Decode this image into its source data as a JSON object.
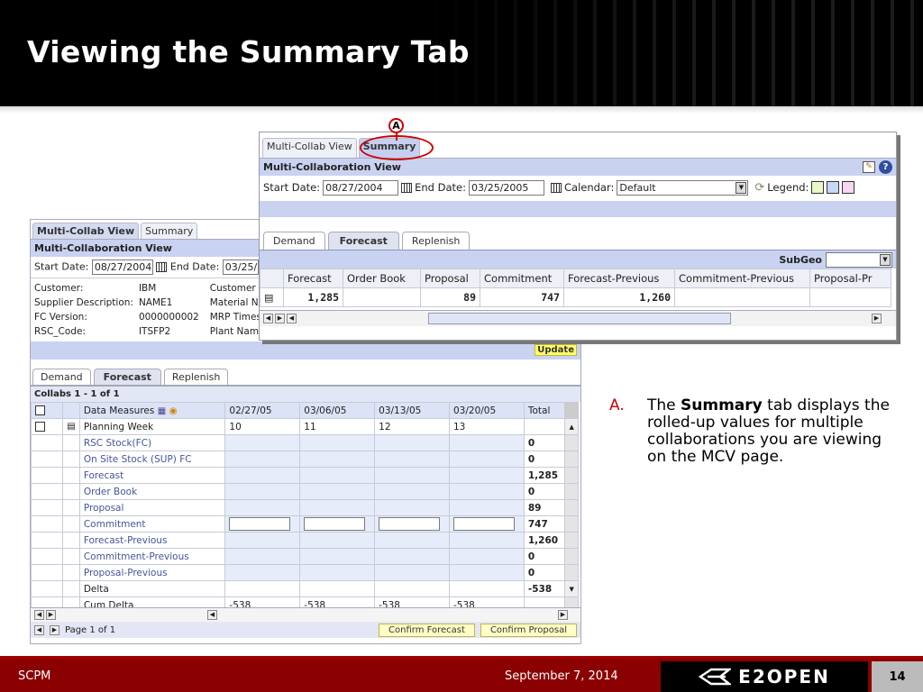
{
  "slide": {
    "title": "Viewing the Summary Tab",
    "footer_left": "SCPM",
    "footer_date": "September 7, 2014",
    "logo_text": "E2OPEN",
    "page_number": "14"
  },
  "callout": {
    "marker": "A",
    "letter": "A.",
    "prefix": "The",
    "bold": "Summary",
    "rest": "tab displays the rolled-up values for multiple collaborations you are viewing on the MCV page."
  },
  "front": {
    "tabs": [
      "Multi-Collab View",
      "Summary"
    ],
    "section_title": "Multi-Collaboration View",
    "start_label": "Start Date:",
    "start_value": "08/27/2004",
    "end_label": "End Date:",
    "end_value": "03/25/2005",
    "calendar_label": "Calendar:",
    "calendar_value": "Default",
    "legend_label": "Legend:",
    "legend_colors": [
      "#e8f8c8",
      "#c8d8f8",
      "#f8d8f0"
    ],
    "subtabs": [
      "Demand",
      "Forecast",
      "Replenish"
    ],
    "subgeo_label": "SubGeo",
    "columns": [
      "Forecast",
      "Order Book",
      "Proposal",
      "Commitment",
      "Forecast-Previous",
      "Commitment-Previous",
      "Proposal-Pr"
    ],
    "row": [
      "1,285",
      "",
      "89",
      "747",
      "1,260",
      "",
      ""
    ]
  },
  "back": {
    "tabs": [
      "Multi-Collab View",
      "Summary"
    ],
    "section_title": "Multi-Collaboration View",
    "start_label": "Start Date:",
    "start_value": "08/27/2004",
    "end_label": "End Date:",
    "end_value": "03/25/",
    "info": [
      [
        "Customer:",
        "IBM",
        "Customer"
      ],
      [
        "Supplier Description:",
        "NAME1",
        "Material Nc"
      ],
      [
        "FC Version:",
        "0000000002",
        "MRP Times"
      ],
      [
        "RSC_Code:",
        "ITSFP2",
        "Plant Name"
      ]
    ],
    "update_label": "Update",
    "subtabs": [
      "Demand",
      "Forecast",
      "Replenish"
    ],
    "collabs_label": "Collabs 1 - 1 of 1",
    "grid_header": [
      "Data Measures",
      "02/27/05",
      "03/06/05",
      "03/13/05",
      "03/20/05",
      "Total"
    ],
    "rows": [
      {
        "label": "Planning Week",
        "vals": [
          "10",
          "11",
          "12",
          "13",
          ""
        ],
        "link": false
      },
      {
        "label": "RSC Stock(FC)",
        "vals": [
          "",
          "",
          "",
          "",
          "0"
        ],
        "link": true
      },
      {
        "label": "On Site Stock (SUP) FC",
        "vals": [
          "",
          "",
          "",
          "",
          "0"
        ],
        "link": true
      },
      {
        "label": "Forecast",
        "vals": [
          "",
          "",
          "",
          "",
          "1,285"
        ],
        "link": true
      },
      {
        "label": "Order Book",
        "vals": [
          "",
          "",
          "",
          "",
          "0"
        ],
        "link": true
      },
      {
        "label": "Proposal",
        "vals": [
          "",
          "",
          "",
          "",
          "89"
        ],
        "link": true
      },
      {
        "label": "Commitment",
        "vals": [
          "",
          "",
          "",
          "",
          "747"
        ],
        "link": true,
        "inputs": true
      },
      {
        "label": "Forecast-Previous",
        "vals": [
          "",
          "",
          "",
          "",
          "1,260"
        ],
        "link": true
      },
      {
        "label": "Commitment-Previous",
        "vals": [
          "",
          "",
          "",
          "",
          "0"
        ],
        "link": true
      },
      {
        "label": "Proposal-Previous",
        "vals": [
          "",
          "",
          "",
          "",
          "0"
        ],
        "link": true
      },
      {
        "label": "Delta",
        "vals": [
          "",
          "",
          "",
          "",
          "-538"
        ],
        "link": false
      },
      {
        "label": "Cum Delta",
        "vals": [
          "-538",
          "-538",
          "-538",
          "-538",
          ""
        ],
        "link": false
      }
    ],
    "page_label": "Page 1 of 1",
    "confirm_forecast": "Confirm Forecast",
    "confirm_proposal": "Confirm Proposal"
  }
}
